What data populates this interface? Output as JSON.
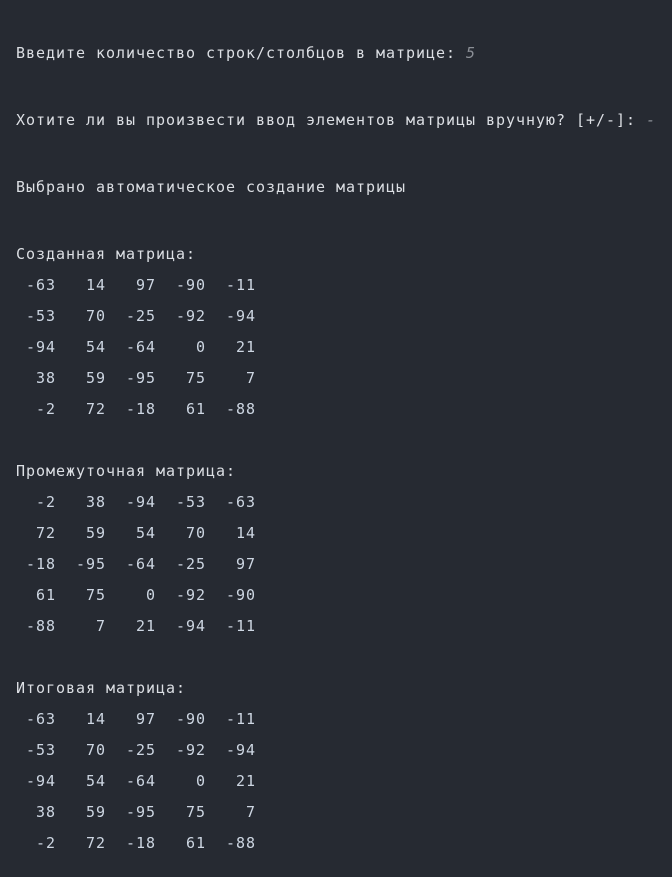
{
  "console": {
    "prompt_size": "Введите количество строк/столбцов в матрице: ",
    "input_size": "5",
    "prompt_manual": "Хотите ли вы произвести ввод элементов матрицы вручную? [+/-]: ",
    "input_manual": "-",
    "auto_message": "Выбрано автоматическое создание матрицы",
    "matrices": [
      {
        "title": "Созданная матрица:",
        "rows": [
          [
            -63,
            14,
            97,
            -90,
            -11
          ],
          [
            -53,
            70,
            -25,
            -92,
            -94
          ],
          [
            -94,
            54,
            -64,
            0,
            21
          ],
          [
            38,
            59,
            -95,
            75,
            7
          ],
          [
            -2,
            72,
            -18,
            61,
            -88
          ]
        ]
      },
      {
        "title": "Промежуточная матрица:",
        "rows": [
          [
            -2,
            38,
            -94,
            -53,
            -63
          ],
          [
            72,
            59,
            54,
            70,
            14
          ],
          [
            -18,
            -95,
            -64,
            -25,
            97
          ],
          [
            61,
            75,
            0,
            -92,
            -90
          ],
          [
            -88,
            7,
            21,
            -94,
            -11
          ]
        ]
      },
      {
        "title": "Итоговая матрица:",
        "rows": [
          [
            -63,
            14,
            97,
            -90,
            -11
          ],
          [
            -53,
            70,
            -25,
            -92,
            -94
          ],
          [
            -94,
            54,
            -64,
            0,
            21
          ],
          [
            38,
            59,
            -95,
            75,
            7
          ],
          [
            -2,
            72,
            -18,
            61,
            -88
          ]
        ]
      }
    ]
  }
}
